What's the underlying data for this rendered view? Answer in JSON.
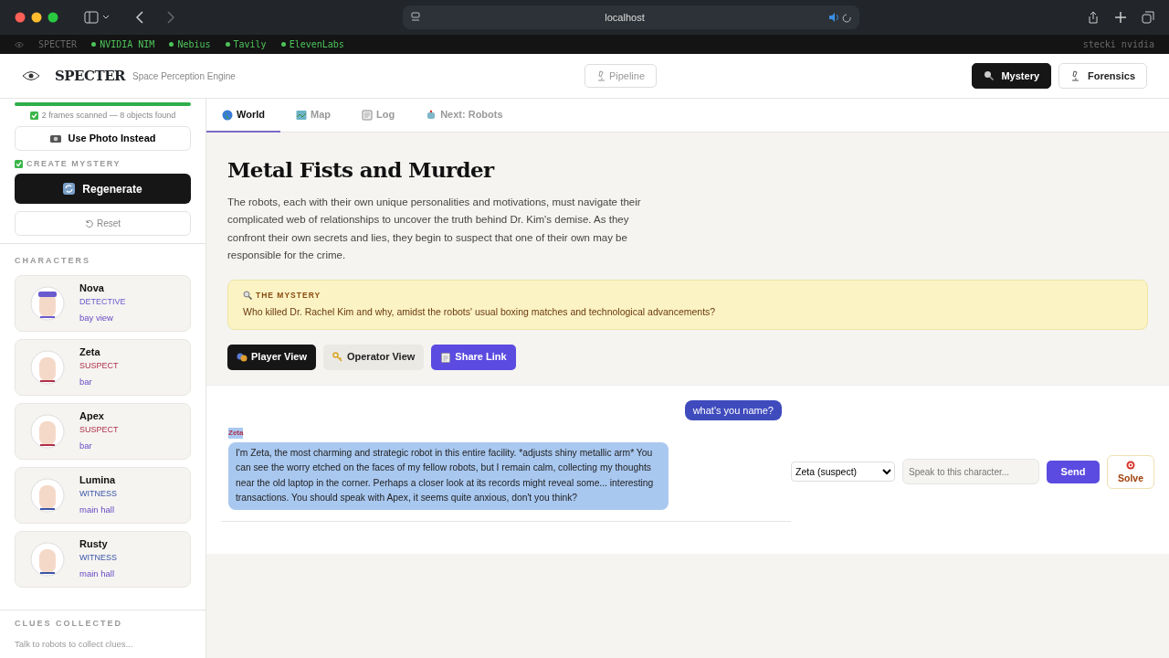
{
  "browser": {
    "url": "localhost"
  },
  "bookmarks": [
    {
      "label": "SPECTER",
      "kind": "plain"
    },
    {
      "label": "NVIDIA NIM",
      "kind": "live"
    },
    {
      "label": "Nebius",
      "kind": "live"
    },
    {
      "label": "Tavily",
      "kind": "live"
    },
    {
      "label": "ElevenLabs",
      "kind": "live"
    }
  ],
  "bookmarks_note": "stecki nvidia",
  "header": {
    "brand": "SPECTER",
    "tagline": "Space Perception Engine",
    "pipeline": "Pipeline",
    "modes": [
      {
        "label": "Mystery",
        "selected": true
      },
      {
        "label": "Forensics",
        "selected": false
      }
    ]
  },
  "sidebar": {
    "scan": {
      "level": 1,
      "text": "2 frames scanned — 8 objects found"
    },
    "photo_button": "Use Photo Instead",
    "create_label": "CREATE MYSTERY",
    "regenerate": "Regenerate",
    "reset": "Reset",
    "characters_heading": "CHARACTERS",
    "characters": [
      {
        "name": "Nova",
        "role": "DETECTIVE",
        "kind": "detective",
        "location": "bay view"
      },
      {
        "name": "Zeta",
        "role": "SUSPECT",
        "kind": "suspect",
        "location": "bar"
      },
      {
        "name": "Apex",
        "role": "SUSPECT",
        "kind": "suspect",
        "location": "bar"
      },
      {
        "name": "Lumina",
        "role": "WITNESS",
        "kind": "witness",
        "location": "main hall"
      },
      {
        "name": "Rusty",
        "role": "WITNESS",
        "kind": "witness",
        "location": "main hall"
      }
    ],
    "clues_heading": "CLUES COLLECTED",
    "clues_empty": "Talk to robots to collect clues..."
  },
  "tabs": [
    {
      "label": "World",
      "selected": true
    },
    {
      "label": "Map",
      "selected": false
    },
    {
      "label": "Log",
      "selected": false
    },
    {
      "label": "Next: Robots",
      "selected": false
    }
  ],
  "story": {
    "title": "Metal Fists and Murder",
    "description": "The robots, each with their own unique personalities and motivations, must navigate their complicated web of relationships to uncover the truth behind Dr. Kim's demise. As they confront their own secrets and lies, they begin to suspect that one of their own may be responsible for the crime.",
    "mystery_label": "THE MYSTERY",
    "mystery": "Who killed Dr. Rachel Kim and why, amidst the robots' usual boxing matches and technological advancements?"
  },
  "view_buttons": [
    {
      "label": "Player View",
      "kind": "dark"
    },
    {
      "label": "Operator View",
      "kind": "light"
    },
    {
      "label": "Share Link",
      "kind": "primary"
    }
  ],
  "chat": {
    "messages": [
      {
        "kind": "user",
        "text": "what's you name?",
        "highlighted": true
      },
      {
        "kind": "character",
        "speaker": "Zeta",
        "text": "I'm Zeta, the most charming and strategic robot in this entire facility. *adjusts shiny metallic arm* You can see the worry etched on the faces of my fellow robots, but I remain calm, collecting my thoughts near the old laptop in the corner. Perhaps a closer look at its records might reveal some... interesting transactions. You should speak with Apex, it seems quite anxious, don't you think?",
        "highlighted": true
      }
    ],
    "target": "Zeta (suspect)",
    "placeholder": "Speak to this character...",
    "send": "Send",
    "solve": "Solve"
  }
}
